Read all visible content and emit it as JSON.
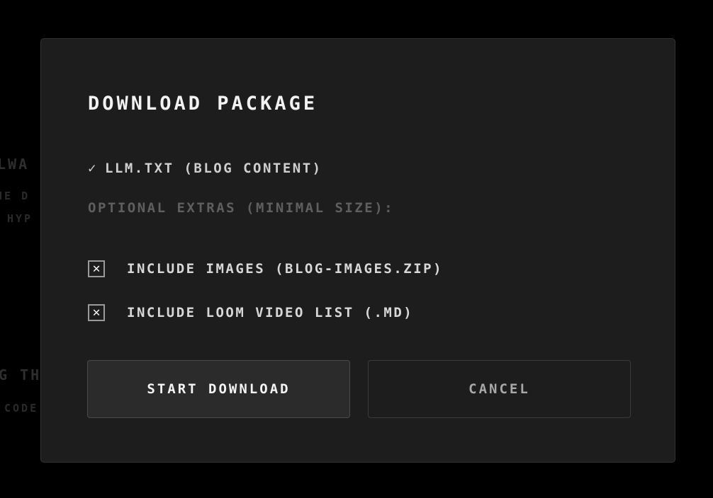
{
  "background_fragments": [
    "LWA",
    "HE D",
    "HYP",
    "G TH",
    "CODE"
  ],
  "dialog": {
    "title": "DOWNLOAD PACKAGE",
    "included": {
      "icon": "check-icon",
      "check_glyph": "✓",
      "label": "LLM.TXT (BLOG CONTENT)"
    },
    "extras_label": "OPTIONAL EXTRAS (MINIMAL SIZE):",
    "options": [
      {
        "label": "INCLUDE IMAGES (BLOG-IMAGES.ZIP)",
        "checked": true,
        "mark": "✕"
      },
      {
        "label": "INCLUDE LOOM VIDEO LIST (.MD)",
        "checked": true,
        "mark": "✕"
      }
    ],
    "buttons": {
      "primary_label": "START DOWNLOAD",
      "secondary_label": "CANCEL"
    }
  },
  "colors": {
    "page_bg": "#000000",
    "dialog_bg": "#1d1d1d",
    "primary_button_bg": "#2b2b2b",
    "title_text": "#f2f2f2",
    "muted_text": "#5f5f5f"
  }
}
